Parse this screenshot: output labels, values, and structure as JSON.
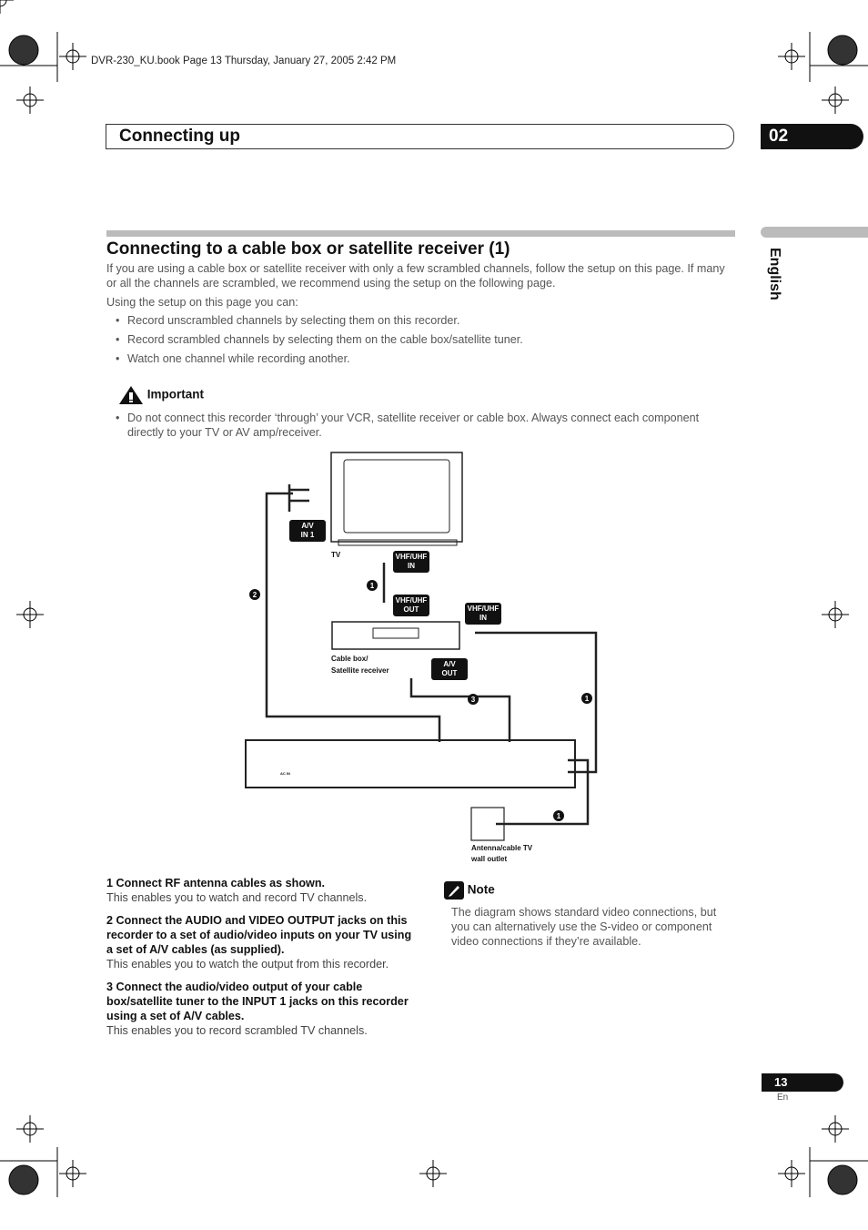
{
  "book_line": "DVR-230_KU.book  Page 13  Thursday, January 27, 2005  2:42 PM",
  "header": {
    "section": "Connecting up",
    "chapter": "02"
  },
  "side_tab": "English",
  "title": "Connecting to a cable box or satellite receiver (1)",
  "intro": "If you are using a cable box or satellite receiver with only a few scrambled channels, follow the setup on this page. If many or all the channels are scrambled, we recommend using the setup on the following page.",
  "using": "Using the setup on this page you can:",
  "bullets": [
    "Record unscrambled channels by selecting them on this recorder.",
    "Record scrambled channels by selecting them on the cable box/satellite tuner.",
    "Watch one channel while recording another."
  ],
  "important": {
    "heading": "Important",
    "text": "Do not connect this recorder ‘through’ your VCR, satellite receiver or cable box. Always connect each component directly to your TV or AV amp/receiver."
  },
  "diagram": {
    "tv": "TV",
    "av_in": [
      "A/V",
      "IN 1"
    ],
    "vhf_in": [
      "VHF/UHF",
      "IN"
    ],
    "vhf_out": [
      "VHF/UHF",
      "OUT"
    ],
    "cable_box": [
      "Cable box/",
      "Satellite receiver"
    ],
    "av_out": [
      "A/V",
      "OUT"
    ],
    "wall": [
      "Antenna/cable TV",
      "wall outlet"
    ],
    "ac_in": "AC IN",
    "markers": [
      "1",
      "2",
      "3"
    ]
  },
  "steps": [
    {
      "heading": "1    Connect RF antenna cables as shown.",
      "text": "This enables you to watch and record TV channels."
    },
    {
      "heading": "2    Connect the AUDIO and VIDEO OUTPUT jacks on this recorder to a set of audio/video inputs on your TV using a set of A/V cables (as supplied).",
      "text": "This enables you to watch the output from this recorder."
    },
    {
      "heading": "3    Connect the audio/video output of your cable box/satellite tuner to the INPUT 1 jacks on this recorder using a set of A/V cables.",
      "text": "This enables you to record scrambled TV channels."
    }
  ],
  "note": {
    "heading": "Note",
    "text": "The diagram shows standard video connections, but you can alternatively use the S-video or component video connections if they’re available."
  },
  "page": {
    "number": "13",
    "lang": "En"
  }
}
